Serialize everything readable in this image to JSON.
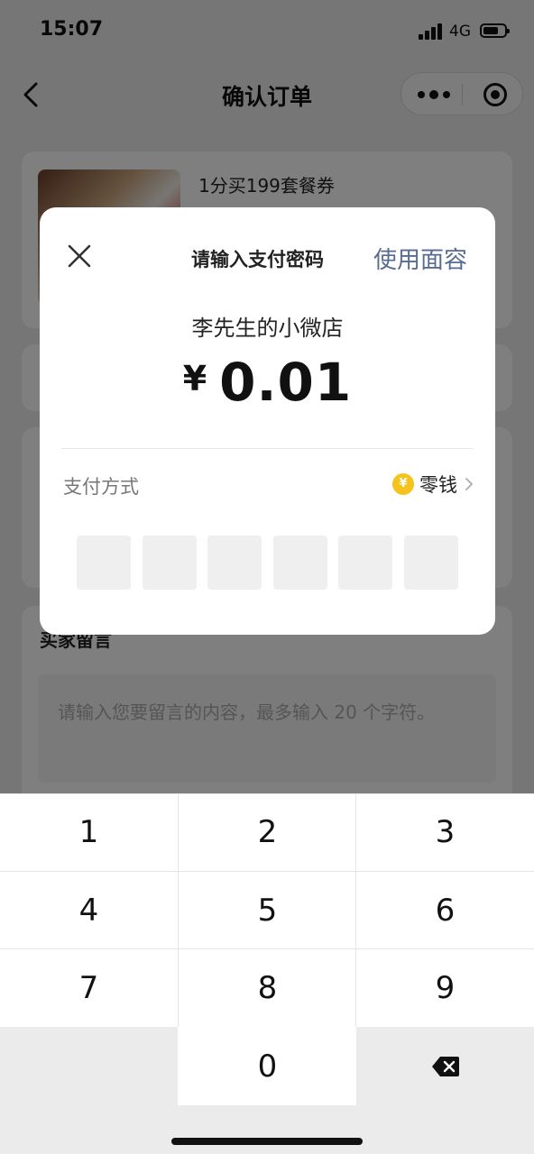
{
  "status_bar": {
    "time": "15:07",
    "network": "4G"
  },
  "nav": {
    "title": "确认订单"
  },
  "order": {
    "product_name": "1分买199套餐券"
  },
  "remark": {
    "title": "买家留言",
    "placeholder": "请输入您要留言的内容，最多输入 20 个字符。"
  },
  "payment": {
    "title": "请输入支付密码",
    "face_pay": "使用面容",
    "merchant": "李先生的小微店",
    "currency": "¥",
    "amount": "0.01",
    "method_label": "支付方式",
    "method_name": "零钱",
    "method_icon_text": "¥",
    "pin_length": 6
  },
  "keypad": {
    "keys": [
      "1",
      "2",
      "3",
      "4",
      "5",
      "6",
      "7",
      "8",
      "9",
      "0"
    ]
  },
  "colors": {
    "link": "#576b95",
    "coin": "#f6c21c"
  }
}
